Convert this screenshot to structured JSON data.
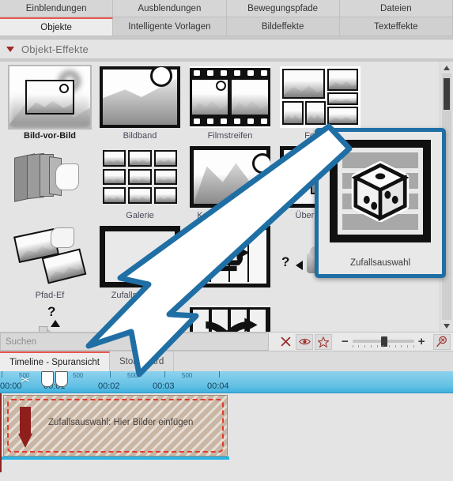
{
  "tabs_row1": [
    {
      "label": "Einblendungen",
      "active": false
    },
    {
      "label": "Ausblendungen",
      "active": false
    },
    {
      "label": "Bewegungspfade",
      "active": false
    },
    {
      "label": "Dateien",
      "active": false
    }
  ],
  "tabs_row2": [
    {
      "label": "Objekte",
      "active": true
    },
    {
      "label": "Intelligente Vorlagen",
      "active": false
    },
    {
      "label": "Bildeffekte",
      "active": false
    },
    {
      "label": "Texteffekte",
      "active": false
    }
  ],
  "section": {
    "title": "Objekt-Effekte",
    "collapse_icon": "triangle-down-icon"
  },
  "effects": [
    {
      "label": "Bild-vor-Bild",
      "art": "pip",
      "selected": true
    },
    {
      "label": "Bildband",
      "art": "bildband",
      "selected": false
    },
    {
      "label": "Filmstreifen",
      "art": "filmstrip",
      "selected": false
    },
    {
      "label": "Foto-Co",
      "art": "collage",
      "selected": false
    },
    {
      "label": "",
      "art": "fan",
      "selected": false
    },
    {
      "label": "Galerie",
      "art": "gallery",
      "selected": false
    },
    {
      "label": "Ken-Burns-Effekt",
      "art": "kenburns",
      "selected": false
    },
    {
      "label": "Überlappung",
      "art": "overlap",
      "selected": false
    },
    {
      "label": "Pfad-Ef",
      "art": "path",
      "selected": false
    },
    {
      "label": "Zufallsauswahl",
      "art": "random",
      "selected": false
    },
    {
      "label": "",
      "art": "loop",
      "selected": false
    },
    {
      "label": "",
      "art": "camera-q",
      "selected": false
    },
    {
      "label": "",
      "art": "cable-q",
      "selected": false
    },
    {
      "label": "",
      "art": "magnet-q",
      "selected": false
    },
    {
      "label": "",
      "art": "shuffle",
      "selected": false
    }
  ],
  "search": {
    "placeholder": "Suchen",
    "value": ""
  },
  "toolbar": {
    "close_icon": "x-icon",
    "preview_icon": "eye-icon",
    "favorite_icon": "star-icon",
    "zoom_out_label": "−",
    "zoom_in_label": "+",
    "zoom_value": 50,
    "zoom_reset_icon": "magnifier-x-icon"
  },
  "timeline": {
    "tabs": [
      {
        "label": "Timeline - Spuransicht",
        "active": true
      },
      {
        "label": "Storyboard",
        "active": false
      }
    ],
    "ruler": {
      "major_ticks": [
        "00:00",
        "00:01",
        "00:02",
        "00:03",
        "00:04"
      ],
      "minor_label": "500",
      "scissors_icon": "scissors-icon"
    },
    "clip": {
      "text": "Zufallsauswahl: Hier Bilder einfügen",
      "arrow_icon": "arrow-down-icon",
      "border_style": "dashed"
    }
  },
  "callout": {
    "label": "Zufallsauswahl",
    "icon": "dice-icon",
    "border_color": "#1f6fa5",
    "arrow_icon": "big-pointer-arrow-icon"
  },
  "scrollbar": {
    "up_icon": "triangle-up-icon",
    "down_icon": "triangle-down-icon"
  },
  "colors": {
    "accent_red": "#e8564f",
    "callout_blue": "#1f6fa5",
    "ruler_blue": "#63c0e4",
    "clip_tan": "#c9b6a4",
    "dash_red": "#e03b2e",
    "icon_red": "#9c2b28"
  }
}
